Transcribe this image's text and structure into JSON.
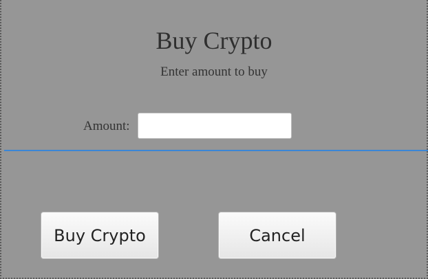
{
  "dialog": {
    "title": "Buy Crypto",
    "subtitle": "Enter amount to buy"
  },
  "form": {
    "amount_label": "Amount:",
    "amount_value": "",
    "amount_placeholder": ""
  },
  "actions": {
    "buy_label": "Buy Crypto",
    "cancel_label": "Cancel"
  },
  "colors": {
    "background": "#969696",
    "separator": "#3a86d6",
    "input_background": "#ffffff"
  }
}
